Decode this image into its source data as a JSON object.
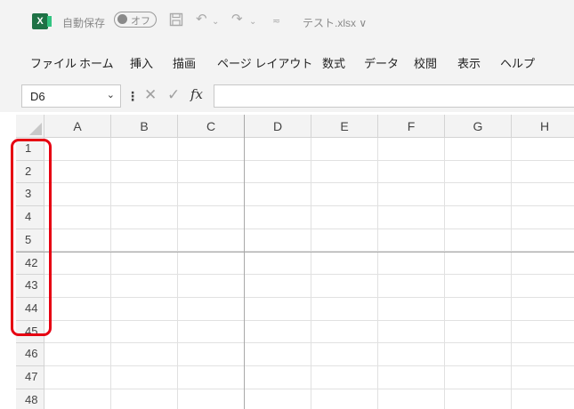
{
  "app": {
    "logo_letter": "X",
    "autosave_label": "自動保存",
    "autosave_state": "オフ",
    "file_name": "テスト.xlsx ∨"
  },
  "menu": [
    "ファイル",
    "ホーム",
    "挿入",
    "描画",
    "ページ レイアウト",
    "数式",
    "データ",
    "校閲",
    "表示",
    "ヘルプ"
  ],
  "formula_bar": {
    "name_box": "D6",
    "fx_label": "fx",
    "formula_value": ""
  },
  "columns": [
    "A",
    "B",
    "C",
    "D",
    "E",
    "F",
    "G",
    "H"
  ],
  "rows": [
    "1",
    "2",
    "3",
    "4",
    "5",
    "42",
    "43",
    "44",
    "45",
    "46",
    "47",
    "48"
  ],
  "colors": {
    "excel_green": "#1e7145",
    "highlight_red": "#e60012",
    "ribbon_bg": "#f3f3f3"
  }
}
